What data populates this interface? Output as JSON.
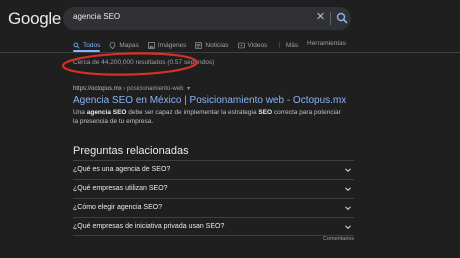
{
  "logo": "Google",
  "search": {
    "query": "agencia SEO"
  },
  "tabs": [
    {
      "label": "Todos",
      "icon": "search-icon",
      "active": true
    },
    {
      "label": "Mapas",
      "icon": "map-pin-icon"
    },
    {
      "label": "Imágenes",
      "icon": "image-icon"
    },
    {
      "label": "Noticias",
      "icon": "news-icon"
    },
    {
      "label": "Videos",
      "icon": "video-icon"
    },
    {
      "label": "Más",
      "icon": "more-icon"
    }
  ],
  "tools_label": "Herramientas",
  "stats": "Cerca de 44,200,000 resultados (0.57 segundos)",
  "result": {
    "url": "https://octopus.mx",
    "path": " › posicionamiento-web",
    "title": "Agencia SEO en México | Posicionamiento web - Octopus.mx",
    "snippet_parts": [
      "Una ",
      "agencia SEO",
      " debe ser capaz de implementar la estrategia ",
      "SEO",
      " correcta para potenciar la presencia de tu empresa."
    ]
  },
  "paa": {
    "title": "Preguntas relacionadas",
    "items": [
      "¿Qué es una agencia de SEO?",
      "¿Qué empresas utilizan SEO?",
      "¿Cómo elegir agencia SEO?",
      "¿Qué empresas de iniciativa privada usan SEO?"
    ]
  },
  "comments_label": "Comentarios",
  "colors": {
    "annotation": "#d93025",
    "link": "#8ab4f8",
    "background": "#1f1f1f"
  }
}
